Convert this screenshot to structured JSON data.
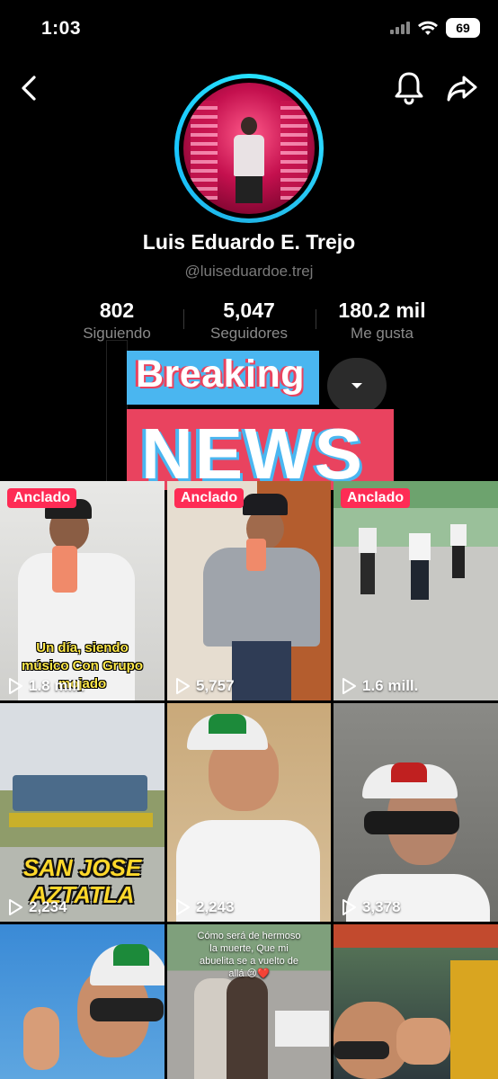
{
  "status_bar": {
    "time": "1:03",
    "battery": "69"
  },
  "nav": {
    "back_icon": "chevron-left-icon",
    "bell_icon": "bell-icon",
    "share_icon": "share-arrow-icon"
  },
  "profile": {
    "name": "Luis Eduardo E. Trejo",
    "handle": "@luiseduardoe.trej",
    "ring_color": "#26e1ff"
  },
  "stats": [
    {
      "value": "802",
      "label": "Siguiendo"
    },
    {
      "value": "5,047",
      "label": "Seguidores"
    },
    {
      "value": "180.2 mil",
      "label": "Me gusta"
    }
  ],
  "overlay": {
    "line1": "Breaking",
    "line2": "NEWS",
    "blue": "#4ab6f0",
    "red": "#e9435f"
  },
  "videos": [
    {
      "badge": "Anclado",
      "views": "1.8 mill.",
      "caption": "Un día, siendo músico Con Grupo mojado"
    },
    {
      "badge": "Anclado",
      "views": "5,757",
      "caption": ""
    },
    {
      "badge": "Anclado",
      "views": "1.6 mill.",
      "caption": ""
    },
    {
      "badge": "",
      "views": "2,234",
      "caption": "SAN JOSE AZTATLA"
    },
    {
      "badge": "",
      "views": "2,243",
      "caption": ""
    },
    {
      "badge": "",
      "views": "3,378",
      "caption": ""
    },
    {
      "badge": "",
      "views": "",
      "caption": ""
    },
    {
      "badge": "",
      "views": "",
      "caption": "Cómo será de hermoso la muerte, Que mi abuelita se a vuelto de allá 😢❤️"
    },
    {
      "badge": "",
      "views": "",
      "caption": ""
    }
  ],
  "accent": "#fe2c55"
}
